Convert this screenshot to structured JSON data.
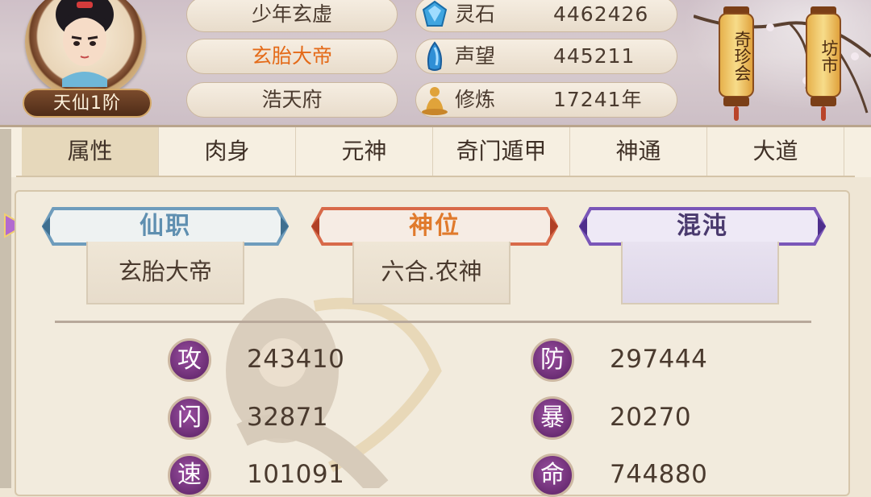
{
  "player": {
    "rank": "天仙1阶",
    "names": [
      "少年玄虚",
      "玄胎大帝",
      "浩天府"
    ]
  },
  "resources": [
    {
      "icon": "spirit-stone-icon",
      "label": "灵石",
      "value": "4462426"
    },
    {
      "icon": "reputation-icon",
      "label": "声望",
      "value": "445211"
    },
    {
      "icon": "cultivation-icon",
      "label": "修炼",
      "value": "17241年"
    }
  ],
  "lanterns": [
    "奇珍会",
    "坊市"
  ],
  "tabs": [
    "属性",
    "肉身",
    "元神",
    "奇门遁甲",
    "神通",
    "大道"
  ],
  "active_tab": "属性",
  "titles": [
    {
      "label": "仙职",
      "value": "玄胎大帝",
      "color": "#5f8fb0"
    },
    {
      "label": "神位",
      "value": "六合.农神",
      "color": "#e07a2c"
    },
    {
      "label": "混沌",
      "value": "",
      "color": "#7a56b8"
    }
  ],
  "stats": [
    {
      "glyph": "攻",
      "value": "243410"
    },
    {
      "glyph": "防",
      "value": "297444"
    },
    {
      "glyph": "闪",
      "value": "32871"
    },
    {
      "glyph": "暴",
      "value": "20270"
    },
    {
      "glyph": "速",
      "value": "101091"
    },
    {
      "glyph": "命",
      "value": "744880"
    }
  ]
}
